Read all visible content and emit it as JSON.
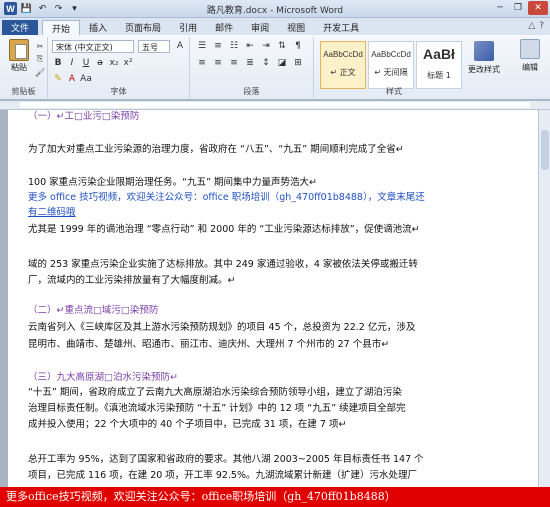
{
  "window": {
    "title": "路凡教育.docx - Microsoft Word",
    "logo_letter": "W",
    "min": "─",
    "restore": "❐",
    "close": "✕"
  },
  "tabs": [
    "文件",
    "开始",
    "插入",
    "页面布局",
    "引用",
    "邮件",
    "审阅",
    "视图",
    "开发工具"
  ],
  "ribbon": {
    "paste_label": "粘贴",
    "clipboard_label": "剪贴板",
    "font_name": "宋体 (中文正文)",
    "font_size": "五号",
    "font_label": "字体",
    "paragraph_label": "段落",
    "styles_label": "样式",
    "styles": [
      {
        "sample": "AaBbCcDd",
        "name": "↵ 正文"
      },
      {
        "sample": "AaBbCcDd",
        "name": "↵ 无间隔"
      },
      {
        "sample": "AaBł",
        "name": "标题 1"
      }
    ],
    "change_styles": "更改样式",
    "edit_label": "编辑"
  },
  "document": {
    "lines": [
      {
        "text": "（一）↵工□业污□染预防",
        "style": "heading"
      },
      {
        "text": "为了加大对重点工业污染源的治理力度，省政府在 “八五”、“九五” 期间顺利完成了全省↵",
        "style": "normal"
      },
      {
        "text": "100 家重点污染企业限期治理任务。“九五” 期间集中力量声势浩大↵",
        "style": "normal"
      },
      {
        "text": "更多 office 技巧视频，欢迎关注公众号：office 职场培训（gh_470ff01b8488），文章末尾还",
        "style": "link"
      },
      {
        "text": "有二维码哦",
        "style": "link-underline"
      },
      {
        "text": "尤其是 1999 年的谪池治理 “零点行动” 和 2000 年的 “工业污染源达标排放”，促使谪池流↵",
        "style": "normal"
      },
      {
        "text": "域的 253 家重点污染企业实施了达标排放。其中 249 家通过验收，4 家被依法关停或搬迁转",
        "style": "normal"
      },
      {
        "text": "厂，流域内的工业污染排放量有了大幅度削减。↵",
        "style": "normal"
      },
      {
        "text": "（二）↵重点流□域污□染预防",
        "style": "heading"
      },
      {
        "text": "云南省列入《三峡库区及其上游水污染预防规划》的项目 45 个，总投资为 22.2 亿元，涉及",
        "style": "normal"
      },
      {
        "text": "昆明市、曲靖市、楚雄州、昭通市、丽江市、迪庆州、大理州 7 个州市的 27 个县市↵",
        "style": "normal"
      },
      {
        "text": "（三）九大高原湖□泊水污染预防↵",
        "style": "heading"
      },
      {
        "text": "“十五” 期间，省政府成立了云南九大高原湖泊水污染综合预防领导小组，建立了湖泊污染",
        "style": "normal"
      },
      {
        "text": "治理目标责任制。《滇池流域水污染预防 “十五” 计划》中的 12 项 “九五” 续建项目全部完",
        "style": "normal"
      },
      {
        "text": "成并投入使用；22 个大项中的 40 个子项目中，已完成 31 项，在建 7 项↵",
        "style": "normal"
      },
      {
        "text": "总开工率为 95%，达到了国家和省政府的要求。其他八湖 2003~2005 年目标责任书 147 个",
        "style": "normal"
      },
      {
        "text": "项目，已完成 116 项，在建 20 项，开工率 92.5%。九湖流域累计新建（扩建）污水处理厂",
        "style": "normal"
      }
    ]
  },
  "banner": {
    "text": "更多office技巧视频，欢迎关注公众号：office职场培训（gh_470ff01b8488）"
  }
}
